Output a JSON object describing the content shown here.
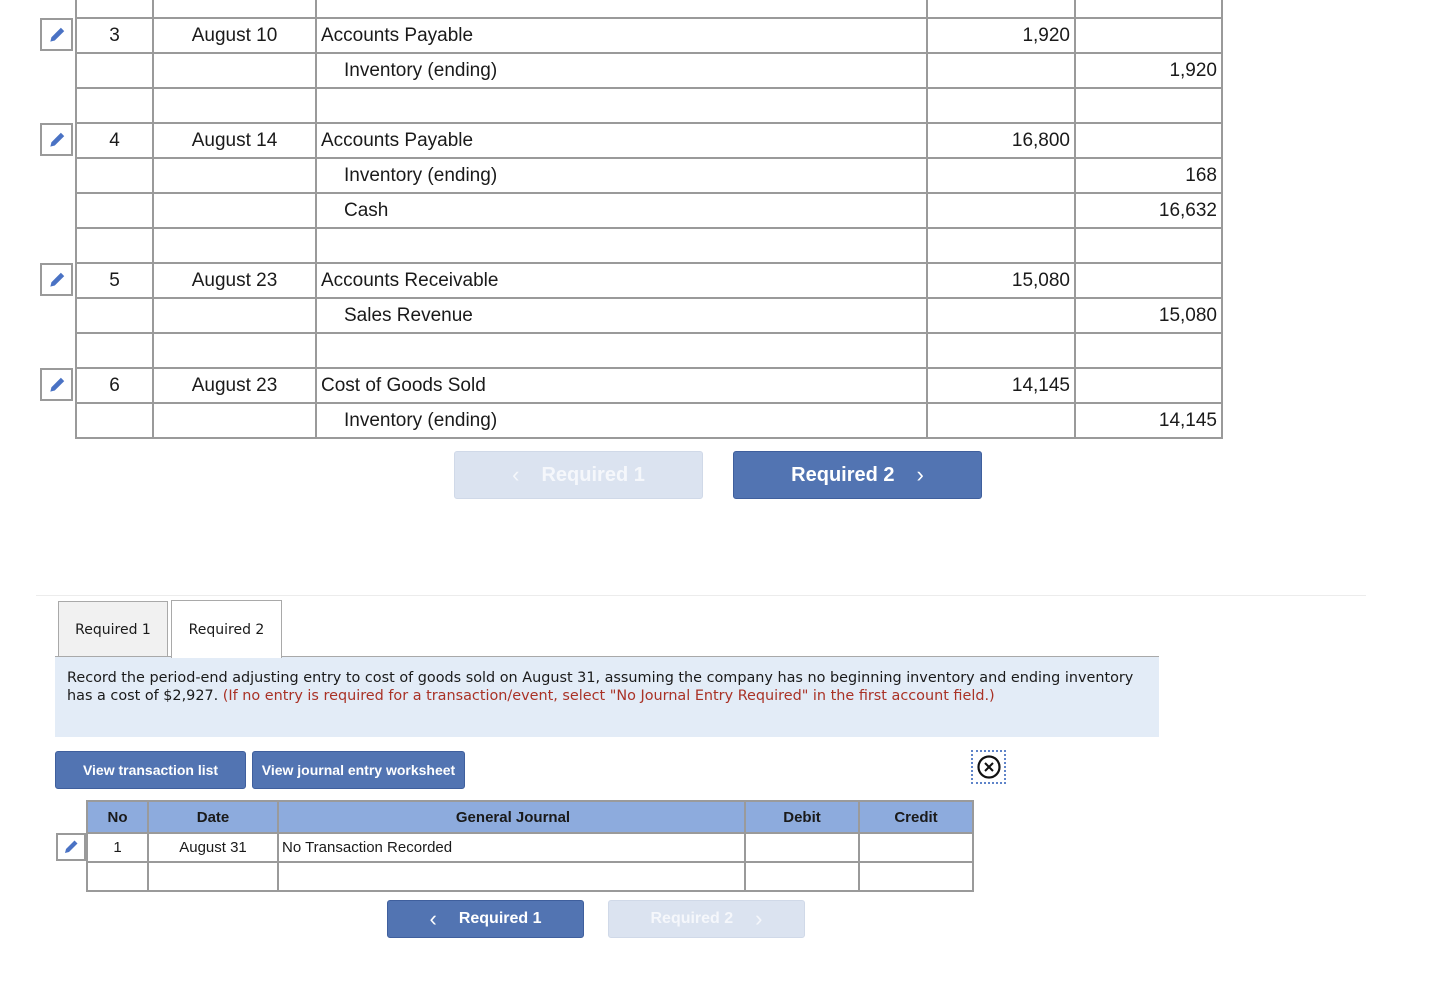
{
  "top_journal": {
    "rows": [
      {
        "no": "",
        "date": "",
        "account": "",
        "indent": false,
        "debit": "",
        "credit": "",
        "editable": false
      },
      {
        "no": "3",
        "date": "August 10",
        "account": "Accounts Payable",
        "indent": false,
        "debit": "1,920",
        "credit": "",
        "editable": true
      },
      {
        "no": "",
        "date": "",
        "account": "Inventory (ending)",
        "indent": true,
        "debit": "",
        "credit": "1,920",
        "editable": false
      },
      {
        "no": "",
        "date": "",
        "account": "",
        "indent": false,
        "debit": "",
        "credit": "",
        "editable": false
      },
      {
        "no": "4",
        "date": "August 14",
        "account": "Accounts Payable",
        "indent": false,
        "debit": "16,800",
        "credit": "",
        "editable": true
      },
      {
        "no": "",
        "date": "",
        "account": "Inventory (ending)",
        "indent": true,
        "debit": "",
        "credit": "168",
        "editable": false
      },
      {
        "no": "",
        "date": "",
        "account": "Cash",
        "indent": true,
        "debit": "",
        "credit": "16,632",
        "editable": false
      },
      {
        "no": "",
        "date": "",
        "account": "",
        "indent": false,
        "debit": "",
        "credit": "",
        "editable": false
      },
      {
        "no": "5",
        "date": "August 23",
        "account": "Accounts Receivable",
        "indent": false,
        "debit": "15,080",
        "credit": "",
        "editable": true
      },
      {
        "no": "",
        "date": "",
        "account": "Sales Revenue",
        "indent": true,
        "debit": "",
        "credit": "15,080",
        "editable": false
      },
      {
        "no": "",
        "date": "",
        "account": "",
        "indent": false,
        "debit": "",
        "credit": "",
        "editable": false
      },
      {
        "no": "6",
        "date": "August 23",
        "account": "Cost of Goods Sold",
        "indent": false,
        "debit": "14,145",
        "credit": "",
        "editable": true
      },
      {
        "no": "",
        "date": "",
        "account": "Inventory (ending)",
        "indent": true,
        "debit": "",
        "credit": "14,145",
        "editable": false
      }
    ]
  },
  "top_nav": {
    "prev_label": "Required 1",
    "next_label": "Required 2",
    "prev_chevron": "‹",
    "next_chevron": "›"
  },
  "tabs": [
    {
      "label": "Required 1",
      "active": false
    },
    {
      "label": "Required 2",
      "active": true
    }
  ],
  "instructions": {
    "main": "Record the period-end adjusting entry to cost of goods sold on August 31, assuming the company has no beginning inventory and ending inventory has a cost of $2,927. ",
    "note": "(If no entry is required for a transaction/event, select \"No Journal Entry Required\" in the first account field.)"
  },
  "worksheet_buttons": {
    "transaction_list": "View transaction list",
    "journal_worksheet": "View journal entry worksheet"
  },
  "bottom_journal": {
    "headers": {
      "no": "No",
      "date": "Date",
      "account": "General Journal",
      "debit": "Debit",
      "credit": "Credit"
    },
    "rows": [
      {
        "no": "1",
        "date": "August 31",
        "account": "No Transaction Recorded",
        "debit": "",
        "credit": ""
      },
      {
        "no": "",
        "date": "",
        "account": "",
        "debit": "",
        "credit": ""
      }
    ]
  },
  "bottom_nav": {
    "prev_label": "Required 1",
    "next_label": "Required 2",
    "prev_chevron": "‹",
    "next_chevron": "›"
  },
  "colors": {
    "accent_blue": "#5274b2",
    "disabled_button": "#dbe3f0",
    "table_header": "#8dabdd",
    "instruction_bg": "#e3ecf7",
    "note_red": "#a93226",
    "pencil_icon": "#4a72c4"
  }
}
